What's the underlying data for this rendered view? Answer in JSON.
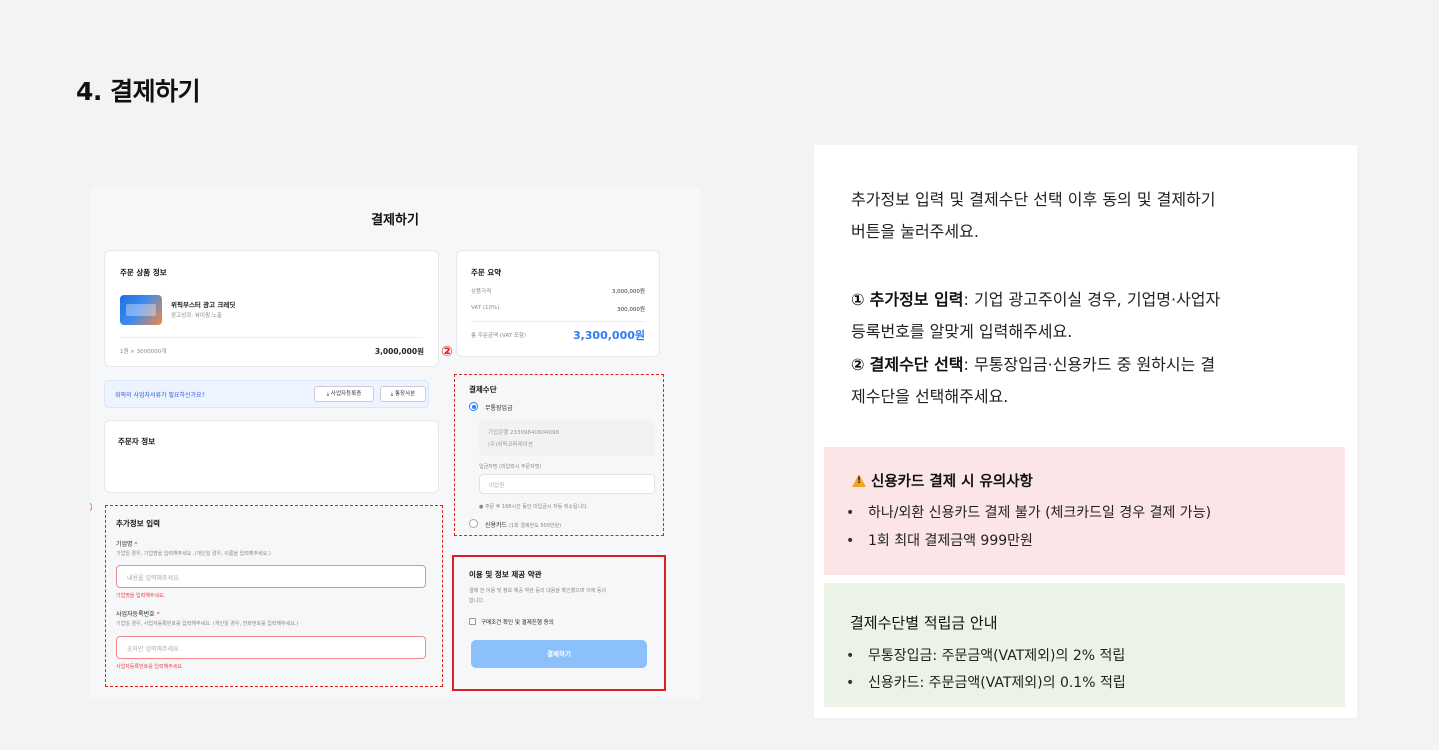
{
  "page": {
    "title": "4. 결제하기"
  },
  "screenshot": {
    "title": "결제하기",
    "order_product": {
      "heading": "주문 상품 정보",
      "product_name": "위픽부스터 광고 크레딧",
      "product_sub": "광고성과: 뷰이핑,노출",
      "quantity": "1원 × 3000000개",
      "price": "3,000,000원"
    },
    "summary": {
      "heading": "주문 요약",
      "rows": [
        {
          "label": "상품가격",
          "value": "3,000,000원"
        },
        {
          "label": "VAT (10%)",
          "value": "300,000원"
        }
      ],
      "total_label": "총 주문금액 (VAT 포함)",
      "total_value": "3,300,000원"
    },
    "docs_banner": {
      "text": "위픽의 사업자서류가 필요하신가요?",
      "btn_business": "⤓ 사업자등록증",
      "btn_bank": "⤓ 통장사본"
    },
    "orderer": {
      "heading": "주문자 정보"
    },
    "extra": {
      "marker": "①",
      "heading": "추가정보 입력",
      "company_label": "기업명",
      "required": "*",
      "company_help": "기업일 경우, 기업명을 입력해주세요. (개인일 경우, 이름을 입력해주세요.)",
      "company_placeholder": "내용을 입력해주세요.",
      "company_error": "기업명을 입력해주세요.",
      "bizno_label": "사업자등록번호",
      "bizno_help": "기업일 경우, 사업자등록번호를 입력해주세요. (개인일 경우, 전화번호를 입력해주세요.)",
      "bizno_placeholder": "숫자만 입력해주세요.",
      "bizno_error": "사업자등록번호를 입력해주세요."
    },
    "payment": {
      "marker": "②",
      "heading": "결제수단",
      "bank_label": "무통장입금",
      "bank_account": "기업은행 23309840604098",
      "bank_holder": "(주)위픽코퍼레이션",
      "depositor_label": "입금자명 (미입력시 주문자명)",
      "depositor_placeholder": "이입원",
      "notice": "● 주문 후 168시간 동안 미입금시 자동 취소됩니다.",
      "card_label": "신용카드",
      "card_note": "(1회 결제한도 500만원)"
    },
    "terms": {
      "heading": "이용 및 정보 제공 약관",
      "desc_line1": "결제 전 이용 및 정보 제공 약관 등의 내용을 확인했으며 이에 동의",
      "desc_line2": "합니다.",
      "agree_label": "구매조건 확인 및 결제진행 동의",
      "pay_button": "결제하기"
    }
  },
  "info": {
    "intro_line1": "추가정보 입력 및 결제수단 선택 이후 동의 및 결제하기",
    "intro_line2": "버튼을 눌러주세요.",
    "item1_marker": "①",
    "item1_bold": "추가정보 입력",
    "item1_rest": ": 기업 광고주이실 경우, 기업명·사업자",
    "item1_line2": "등록번호를 알맞게 입력해주세요.",
    "item2_marker": "②",
    "item2_bold": "결제수단 선택",
    "item2_rest": ": 무통장입금·신용카드 중 원하시는 결",
    "item2_line2": "제수단을 선택해주세요.",
    "warning": {
      "icon": "warning-icon",
      "title": "신용카드 결제 시 유의사항",
      "items": [
        "하나/외환 신용카드 결제 불가 (체크카드일 경우 결제 가능)",
        "1회 최대 결제금액 999만원"
      ]
    },
    "points": {
      "title": "결제수단별 적립금 안내",
      "items": [
        "무통장입금: 주문금액(VAT제외)의 2% 적립",
        "신용카드: 주문금액(VAT제외)의 0.1% 적립"
      ]
    }
  },
  "colors": {
    "annotation_red": "#e02020",
    "accent_blue": "#2f7cf6",
    "pink_box": "#fbe5e6",
    "green_box": "#eaf3e6"
  }
}
